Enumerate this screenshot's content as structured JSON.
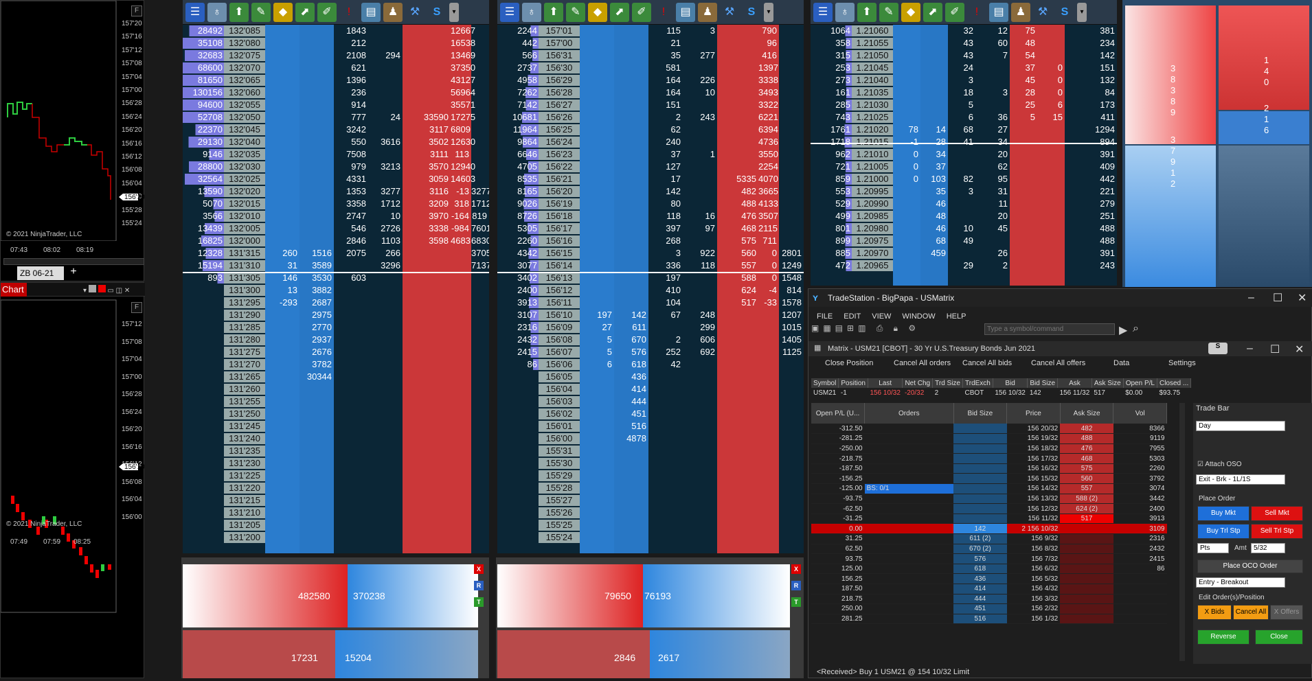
{
  "chart1": {
    "y": [
      "157'20",
      "157'16",
      "157'12",
      "157'08",
      "157'04",
      "157'00",
      "156'28",
      "156'24",
      "156'20",
      "156'16",
      "156'12",
      "156'08",
      "156'04",
      "156'00",
      "155'28",
      "155'24"
    ],
    "price_tag": "156'10",
    "x": [
      "07:43",
      "08:02",
      "08:19"
    ],
    "copyright": "© 2021 NinjaTrader, LLC",
    "fbtn": "F",
    "tab": "ZB 06-21",
    "add": "+"
  },
  "chart2": {
    "title": "Chart",
    "y": [
      "157'12",
      "157'08",
      "157'04",
      "157'00",
      "156'28",
      "156'24",
      "156'20",
      "156'16",
      "156'12",
      "156'08",
      "156'04",
      "156'00"
    ],
    "price_tag": "156'10",
    "x": [
      "07:49",
      "07:59",
      "08:25"
    ],
    "copyright": "© 2021 NinjaTrader, LLC",
    "fbtn": "F"
  },
  "ladder1": {
    "rows": [
      [
        "28492",
        "132'085",
        "",
        "",
        "1843",
        "",
        "",
        "12667"
      ],
      [
        "35108",
        "132'080",
        "",
        "",
        "212",
        "",
        "",
        "16538"
      ],
      [
        "32683",
        "132'075",
        "",
        "",
        "2108",
        "294",
        "",
        "13469"
      ],
      [
        "68600",
        "132'070",
        "",
        "",
        "621",
        "",
        "",
        "37350"
      ],
      [
        "81650",
        "132'065",
        "",
        "",
        "1396",
        "",
        "",
        "43127"
      ],
      [
        "130156",
        "132'060",
        "",
        "",
        "236",
        "",
        "",
        "56964"
      ],
      [
        "94600",
        "132'055",
        "",
        "",
        "914",
        "",
        "",
        "35571"
      ],
      [
        "52708",
        "132'050",
        "",
        "",
        "777",
        "24",
        "33590",
        "17275"
      ],
      [
        "22370",
        "132'045",
        "",
        "",
        "3242",
        "",
        "3117",
        "6809"
      ],
      [
        "29130",
        "132'040",
        "",
        "",
        "550",
        "3616",
        "3502",
        "12630"
      ],
      [
        "9146",
        "132'035",
        "",
        "",
        "7508",
        "",
        "3111",
        "113"
      ],
      [
        "28800",
        "132'030",
        "",
        "",
        "979",
        "3213",
        "3570",
        "12940"
      ],
      [
        "32564",
        "132'025",
        "",
        "",
        "4331",
        "",
        "3059",
        "14603"
      ],
      [
        "13590",
        "132'020",
        "",
        "",
        "1353",
        "3277",
        "3116",
        "-13",
        "3277"
      ],
      [
        "5070",
        "132'015",
        "",
        "",
        "3358",
        "1712",
        "3209",
        "318",
        "1712"
      ],
      [
        "3566",
        "132'010",
        "",
        "",
        "2747",
        "10",
        "3970",
        "-164",
        "819"
      ],
      [
        "13439",
        "132'005",
        "",
        "",
        "546",
        "2726",
        "3338",
        "-984",
        "7601"
      ],
      [
        "16825",
        "132'000",
        "",
        "",
        "2846",
        "1103",
        "3598",
        "4683",
        "6830"
      ],
      [
        "12328",
        "131'315",
        "260",
        "1516",
        "2075",
        "266",
        "",
        "",
        "3705"
      ],
      [
        "15194",
        "131'310",
        "31",
        "3589",
        "",
        "3296",
        "",
        "",
        "7137"
      ],
      [
        "893",
        "131'305",
        "146",
        "3530",
        "603",
        "",
        "",
        "",
        ""
      ],
      [
        "",
        "131'300",
        "13",
        "3882",
        "",
        "",
        "",
        "",
        ""
      ],
      [
        "",
        "131'295",
        "-293",
        "2687",
        "",
        "",
        "",
        "",
        ""
      ],
      [
        "",
        "131'290",
        "",
        "2975",
        "",
        "",
        "",
        "",
        ""
      ],
      [
        "",
        "131'285",
        "",
        "2770",
        "",
        "",
        "",
        "",
        ""
      ],
      [
        "",
        "131'280",
        "",
        "2937",
        "",
        "",
        "",
        "",
        ""
      ],
      [
        "",
        "131'275",
        "",
        "2676",
        "",
        "",
        "",
        "",
        ""
      ],
      [
        "",
        "131'270",
        "",
        "3782",
        "",
        "",
        "",
        "",
        ""
      ],
      [
        "",
        "131'265",
        "",
        "30344",
        "",
        "",
        "",
        "",
        ""
      ],
      [
        "",
        "131'260",
        "",
        "",
        "",
        "",
        "",
        "",
        ""
      ],
      [
        "",
        "131'255",
        "",
        "",
        "",
        "",
        "",
        "",
        ""
      ],
      [
        "",
        "131'250",
        "",
        "",
        "",
        "",
        "",
        "",
        ""
      ],
      [
        "",
        "131'245",
        "",
        "",
        "",
        "",
        "",
        "",
        ""
      ],
      [
        "",
        "131'240",
        "",
        "",
        "",
        "",
        "",
        "",
        ""
      ],
      [
        "",
        "131'235",
        "",
        "",
        "",
        "",
        "",
        "",
        ""
      ],
      [
        "",
        "131'230",
        "",
        "",
        "",
        "",
        "",
        "",
        ""
      ],
      [
        "",
        "131'225",
        "",
        "",
        "",
        "",
        "",
        "",
        ""
      ],
      [
        "",
        "131'220",
        "",
        "",
        "",
        "",
        "",
        "",
        ""
      ],
      [
        "",
        "131'215",
        "",
        "",
        "",
        "",
        "",
        "",
        ""
      ],
      [
        "",
        "131'210",
        "",
        "",
        "",
        "",
        "",
        "",
        ""
      ],
      [
        "",
        "131'205",
        "",
        "",
        "",
        "",
        "",
        "",
        ""
      ],
      [
        "",
        "131'200",
        "",
        "",
        "",
        "",
        "",
        "",
        ""
      ]
    ],
    "bid_total": "482580",
    "ask_total": "370238",
    "bid_small": "17231",
    "ask_small": "15204"
  },
  "ladder2": {
    "rows": [
      [
        "2244",
        "157'01",
        "",
        "",
        "115",
        "3",
        "",
        "790"
      ],
      [
        "442",
        "157'00",
        "",
        "",
        "21",
        "",
        "",
        "96"
      ],
      [
        "566",
        "156'31",
        "",
        "",
        "35",
        "277",
        "",
        "416"
      ],
      [
        "2737",
        "156'30",
        "",
        "",
        "581",
        "",
        "",
        "1397"
      ],
      [
        "4958",
        "156'29",
        "",
        "",
        "164",
        "226",
        "",
        "3338"
      ],
      [
        "7262",
        "156'28",
        "",
        "",
        "164",
        "10",
        "",
        "3493"
      ],
      [
        "7142",
        "156'27",
        "",
        "",
        "151",
        "",
        "",
        "3322"
      ],
      [
        "10681",
        "156'26",
        "",
        "",
        "2",
        "243",
        "",
        "6221"
      ],
      [
        "11964",
        "156'25",
        "",
        "",
        "62",
        "",
        "",
        "6394"
      ],
      [
        "9864",
        "156'24",
        "",
        "",
        "240",
        "",
        "",
        "4736"
      ],
      [
        "6646",
        "156'23",
        "",
        "",
        "37",
        "1",
        "",
        "3550"
      ],
      [
        "4705",
        "156'22",
        "",
        "",
        "127",
        "",
        "",
        "2254"
      ],
      [
        "8535",
        "156'21",
        "",
        "",
        "17",
        "",
        "5335",
        "4070"
      ],
      [
        "8165",
        "156'20",
        "",
        "",
        "142",
        "",
        "482",
        "3665"
      ],
      [
        "9026",
        "156'19",
        "",
        "",
        "80",
        "",
        "488",
        "4133"
      ],
      [
        "8726",
        "156'18",
        "",
        "",
        "118",
        "16",
        "476",
        "3507"
      ],
      [
        "5305",
        "156'17",
        "",
        "",
        "397",
        "97",
        "468",
        "2115"
      ],
      [
        "2260",
        "156'16",
        "",
        "",
        "268",
        "",
        "575",
        "711"
      ],
      [
        "4342",
        "156'15",
        "",
        "",
        "3",
        "922",
        "560",
        "0",
        "2801"
      ],
      [
        "3077",
        "156'14",
        "",
        "",
        "336",
        "118",
        "557",
        "0",
        "1249"
      ],
      [
        "3402",
        "156'13",
        "",
        "",
        "197",
        "",
        "588",
        "0",
        "1548"
      ],
      [
        "2400",
        "156'12",
        "",
        "",
        "410",
        "",
        "624",
        "-4",
        "814"
      ],
      [
        "3913",
        "156'11",
        "",
        "",
        "104",
        "",
        "517",
        "-33",
        "1578"
      ],
      [
        "3107",
        "156'10",
        "197",
        "142",
        "67",
        "248",
        "",
        "",
        "1207"
      ],
      [
        "2316",
        "156'09",
        "27",
        "611",
        "",
        "299",
        "",
        "",
        "1015"
      ],
      [
        "2432",
        "156'08",
        "5",
        "670",
        "2",
        "606",
        "",
        "",
        "1405"
      ],
      [
        "2415",
        "156'07",
        "5",
        "576",
        "252",
        "692",
        "",
        "",
        "1125"
      ],
      [
        "86",
        "156'06",
        "6",
        "618",
        "42",
        "",
        "",
        "",
        ""
      ],
      [
        "",
        "156'05",
        "",
        "436",
        "",
        "",
        "",
        "",
        ""
      ],
      [
        "",
        "156'04",
        "",
        "414",
        "",
        "",
        "",
        "",
        ""
      ],
      [
        "",
        "156'03",
        "",
        "444",
        "",
        "",
        "",
        "",
        ""
      ],
      [
        "",
        "156'02",
        "",
        "451",
        "",
        "",
        "",
        "",
        ""
      ],
      [
        "",
        "156'01",
        "",
        "516",
        "",
        "",
        "",
        "",
        ""
      ],
      [
        "",
        "156'00",
        "",
        "4878",
        "",
        "",
        "",
        "",
        ""
      ],
      [
        "",
        "155'31",
        "",
        "",
        "",
        "",
        "",
        "",
        ""
      ],
      [
        "",
        "155'30",
        "",
        "",
        "",
        "",
        "",
        "",
        ""
      ],
      [
        "",
        "155'29",
        "",
        "",
        "",
        "",
        "",
        "",
        ""
      ],
      [
        "",
        "155'28",
        "",
        "",
        "",
        "",
        "",
        "",
        ""
      ],
      [
        "",
        "155'27",
        "",
        "",
        "",
        "",
        "",
        "",
        ""
      ],
      [
        "",
        "155'26",
        "",
        "",
        "",
        "",
        "",
        "",
        ""
      ],
      [
        "",
        "155'25",
        "",
        "",
        "",
        "",
        "",
        "",
        ""
      ],
      [
        "",
        "155'24",
        "",
        "",
        "",
        "",
        "",
        "",
        ""
      ]
    ],
    "bid_total": "79650",
    "ask_total": "76193",
    "bid_small": "2846",
    "ask_small": "2617"
  },
  "ladder3": {
    "rows": [
      [
        "1064",
        "1.21060",
        "",
        "",
        "32",
        "12",
        "75",
        "",
        "381"
      ],
      [
        "358",
        "1.21055",
        "",
        "",
        "43",
        "60",
        "48",
        "",
        "234"
      ],
      [
        "315",
        "1.21050",
        "",
        "",
        "43",
        "7",
        "54",
        "",
        "142"
      ],
      [
        "253",
        "1.21045",
        "",
        "",
        "24",
        "",
        "37",
        "0",
        "151"
      ],
      [
        "273",
        "1.21040",
        "",
        "",
        "3",
        "",
        "45",
        "0",
        "132"
      ],
      [
        "161",
        "1.21035",
        "",
        "",
        "18",
        "3",
        "28",
        "0",
        "84"
      ],
      [
        "285",
        "1.21030",
        "",
        "",
        "5",
        "",
        "25",
        "6",
        "173"
      ],
      [
        "743",
        "1.21025",
        "",
        "",
        "6",
        "36",
        "5",
        "15",
        "411"
      ],
      [
        "1761",
        "1.21020",
        "78",
        "14",
        "68",
        "27",
        "",
        "",
        "1294"
      ],
      [
        "1718",
        "1.21015",
        "-1",
        "28",
        "41",
        "34",
        "",
        "",
        "894"
      ],
      [
        "962",
        "1.21010",
        "0",
        "34",
        "",
        "20",
        "",
        "",
        "391"
      ],
      [
        "721",
        "1.21005",
        "0",
        "37",
        "",
        "62",
        "",
        "",
        "409"
      ],
      [
        "859",
        "1.21000",
        "0",
        "103",
        "82",
        "95",
        "",
        "",
        "442"
      ],
      [
        "553",
        "1.20995",
        "",
        "35",
        "3",
        "31",
        "",
        "",
        "221"
      ],
      [
        "529",
        "1.20990",
        "",
        "46",
        "",
        "11",
        "",
        "",
        "279"
      ],
      [
        "499",
        "1.20985",
        "",
        "48",
        "",
        "20",
        "",
        "",
        "251"
      ],
      [
        "801",
        "1.20980",
        "",
        "46",
        "10",
        "45",
        "",
        "",
        "488"
      ],
      [
        "899",
        "1.20975",
        "",
        "68",
        "49",
        "",
        "",
        "",
        "488"
      ],
      [
        "885",
        "1.20970",
        "",
        "459",
        "",
        "26",
        "",
        "",
        "391"
      ],
      [
        "472",
        "1.20965",
        "",
        "",
        "29",
        "2",
        "",
        "",
        "243"
      ]
    ]
  },
  "heat": {
    "left_top": [
      "3",
      "8",
      "3",
      "8",
      "9"
    ],
    "right_top": [
      "1",
      "4",
      "0"
    ],
    "left_bot": [
      "3",
      "7",
      "9",
      "1",
      "2"
    ],
    "right_bot": [
      "2",
      "1",
      "6"
    ]
  },
  "side": {
    "x": "X",
    "r": "R",
    "t": "T"
  },
  "ts": {
    "title": "TradeStation - BigPapa - USMatrix",
    "menu": [
      "FILE",
      "EDIT",
      "VIEW",
      "WINDOW",
      "HELP"
    ],
    "symbol_placeholder": "Type a symbol/command",
    "matrix_title": "Matrix - USM21 [CBOT] - 30 Yr U.S.Treasury Bonds Jun 2021",
    "toolbar": [
      "Close Position",
      "Cancel All orders",
      "Cancel All bids",
      "Cancel All offers",
      "Data",
      "Settings"
    ],
    "quote_headers": [
      "Symbol",
      "Position",
      "Last",
      "Net Chg",
      "Trd Size",
      "TrdExch",
      "Bid",
      "Bid Size",
      "Ask",
      "Ask Size",
      "Open P/L",
      "Closed ..."
    ],
    "quote": [
      "USM21",
      "-1",
      "156 10/32",
      "-20/32",
      "2",
      "CBOT",
      "156 10/32",
      "142",
      "156 11/32",
      "517",
      "$0.00",
      "$93.75"
    ],
    "grid_headers": [
      "Open P/L (U...",
      "Orders",
      "Bid Size",
      "Price",
      "Ask Size",
      "Vol"
    ],
    "grid": [
      [
        "-312.50",
        "",
        "",
        "156 20/32",
        "482",
        "8366"
      ],
      [
        "-281.25",
        "",
        "",
        "156 19/32",
        "488",
        "9119"
      ],
      [
        "-250.00",
        "",
        "",
        "156 18/32",
        "476",
        "7955"
      ],
      [
        "-218.75",
        "",
        "",
        "156 17/32",
        "468",
        "5303"
      ],
      [
        "-187.50",
        "",
        "",
        "156 16/32",
        "575",
        "2260"
      ],
      [
        "-156.25",
        "",
        "",
        "156 15/32",
        "560",
        "3792"
      ],
      [
        "-125.00",
        "BS: 0/1",
        "",
        "156 14/32",
        "557",
        "3074"
      ],
      [
        "-93.75",
        "",
        "",
        "156 13/32",
        "588 (2)",
        "3442"
      ],
      [
        "-62.50",
        "",
        "",
        "156 12/32",
        "624 (2)",
        "2400"
      ],
      [
        "-31.25",
        "",
        "",
        "156 11/32",
        "517",
        "3913"
      ],
      [
        "0.00",
        "",
        "142",
        "2  156 10/32",
        "",
        "3109"
      ],
      [
        "31.25",
        "",
        "611 (2)",
        "156 9/32",
        "",
        "2316"
      ],
      [
        "62.50",
        "",
        "670 (2)",
        "156 8/32",
        "",
        "2432"
      ],
      [
        "93.75",
        "",
        "576",
        "156 7/32",
        "",
        "2415"
      ],
      [
        "125.00",
        "",
        "618",
        "156 6/32",
        "",
        "86"
      ],
      [
        "156.25",
        "",
        "436",
        "156 5/32",
        "",
        ""
      ],
      [
        "187.50",
        "",
        "414",
        "156 4/32",
        "",
        ""
      ],
      [
        "218.75",
        "",
        "444",
        "156 3/32",
        "",
        ""
      ],
      [
        "250.00",
        "",
        "451",
        "156 2/32",
        "",
        ""
      ],
      [
        "281.25",
        "",
        "516",
        "156 1/32",
        "",
        ""
      ]
    ],
    "trade_bar": "Trade Bar",
    "duration": "Day",
    "attach_oso": "Attach OSO",
    "strategy": "Exit - Brk - 1L/1S",
    "place_order": "Place Order",
    "buy_mkt": "Buy Mkt",
    "sell_mkt": "Sell Mkt",
    "buy_trl": "Buy Trl Stp",
    "sell_trl": "Sell Trl Stp",
    "pts": "Pts",
    "amt_label": "Amt",
    "amt": "5/32",
    "place_oco": "Place OCO Order",
    "entry": "Entry - Breakout",
    "edit_label": "Edit Order(s)/Position",
    "x_bids": "X Bids",
    "cancel_all": "Cancel All",
    "x_offers": "X Offers",
    "reverse": "Reverse",
    "close": "Close",
    "status": "<Received> Buy 1 USM21 @ 154 10/32 Limit",
    "s_badge": "S"
  },
  "colors": {
    "bid": "#2e86de",
    "ask": "#e03a3a",
    "ladder_bg": "#0b2636",
    "accent": "#c60000"
  }
}
